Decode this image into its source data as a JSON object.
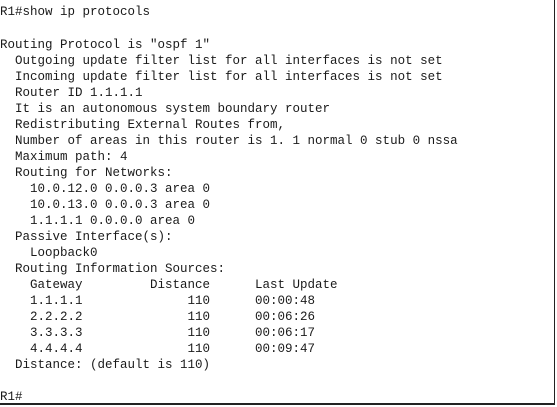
{
  "terminal": {
    "lines": [
      "R1#show ip protocols",
      "",
      "Routing Protocol is \"ospf 1\"",
      "  Outgoing update filter list for all interfaces is not set",
      "  Incoming update filter list for all interfaces is not set",
      "  Router ID 1.1.1.1",
      "  It is an autonomous system boundary router",
      "  Redistributing External Routes from,",
      "  Number of areas in this router is 1. 1 normal 0 stub 0 nssa",
      "  Maximum path: 4",
      "  Routing for Networks:",
      "    10.0.12.0 0.0.0.3 area 0",
      "    10.0.13.0 0.0.0.3 area 0",
      "    1.1.1.1 0.0.0.0 area 0",
      "  Passive Interface(s):",
      "    Loopback0",
      "  Routing Information Sources:",
      "    Gateway         Distance      Last Update",
      "    1.1.1.1              110      00:00:48",
      "    2.2.2.2              110      00:06:26",
      "    3.3.3.3              110      00:06:17",
      "    4.4.4.4              110      00:09:47",
      "  Distance: (default is 110)",
      "",
      "R1#"
    ]
  }
}
